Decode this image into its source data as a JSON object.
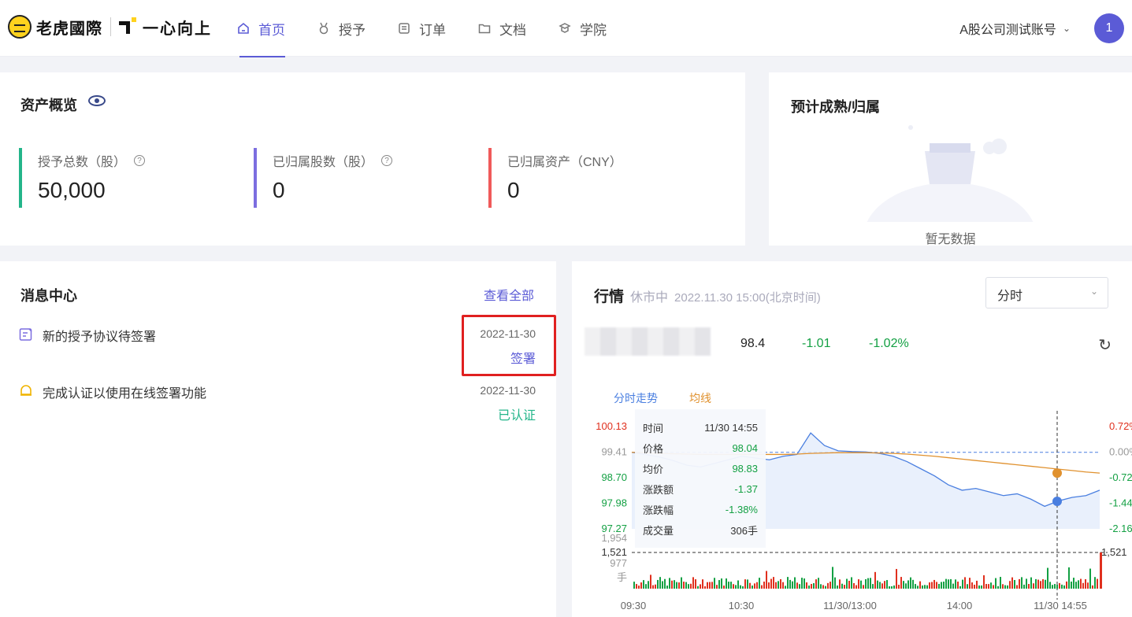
{
  "header": {
    "logo_text": "老虎國際",
    "logo2_text": "一心向上",
    "nav": [
      {
        "label": "首页",
        "icon": "home-icon",
        "active": true
      },
      {
        "label": "授予",
        "icon": "medal-icon",
        "active": false
      },
      {
        "label": "订单",
        "icon": "order-icon",
        "active": false
      },
      {
        "label": "文档",
        "icon": "folder-icon",
        "active": false
      },
      {
        "label": "学院",
        "icon": "academy-icon",
        "active": false
      }
    ],
    "account_label": "A股公司测试账号",
    "avatar_text": "1"
  },
  "assets": {
    "title": "资产概览",
    "stats": [
      {
        "label": "授予总数（股）",
        "value": "50,000",
        "color": "#23b58a",
        "help": true
      },
      {
        "label": "已归属股数（股）",
        "value": "0",
        "color": "#7c6ee0",
        "help": true
      },
      {
        "label": "已归属资产（CNY）",
        "value": "0",
        "color": "#f05a5a",
        "help": false
      }
    ]
  },
  "vesting": {
    "title": "预计成熟/归属",
    "empty_text": "暂无数据"
  },
  "messages": {
    "title": "消息中心",
    "view_all": "查看全部",
    "items": [
      {
        "text": "新的授予协议待签署",
        "date": "2022-11-30",
        "action": "签署",
        "action_color": "#5b5bd6",
        "icon": "sign-document-icon"
      },
      {
        "text": "完成认证以使用在线签署功能",
        "date": "2022-11-30",
        "action": "已认证",
        "action_color": "#23b58a",
        "icon": "bell-icon"
      }
    ]
  },
  "quote": {
    "title": "行情",
    "status": "休市中",
    "time": "2022.11.30 15:00(北京时间)",
    "period": "分时",
    "price": "98.4",
    "change": "-1.01",
    "change_pct": "-1.02%",
    "legend_trend": "分时走势",
    "legend_avg": "均线",
    "colors": {
      "up": "#e0301e",
      "down": "#13a043",
      "trend": "#4a7fe0",
      "avg": "#e0912e"
    },
    "tooltip": {
      "rows": [
        {
          "k": "时间",
          "v": "11/30 14:55",
          "c": "#333"
        },
        {
          "k": "价格",
          "v": "98.04",
          "c": "#13a043"
        },
        {
          "k": "均价",
          "v": "98.83",
          "c": "#13a043"
        },
        {
          "k": "涨跌额",
          "v": "-1.37",
          "c": "#13a043"
        },
        {
          "k": "涨跌幅",
          "v": "-1.38%",
          "c": "#13a043"
        },
        {
          "k": "成交量",
          "v": "306手",
          "c": "#333"
        }
      ]
    }
  },
  "chart_data": {
    "type": "line",
    "x_ticks": [
      "09:30",
      "10:30",
      "11/30/13:00",
      "14:00",
      "11/30 14:55"
    ],
    "y_left_ticks": [
      "100.13",
      "99.41",
      "98.70",
      "97.98",
      "97.27"
    ],
    "y_right_ticks": [
      "0.72%",
      "0.00%",
      "-0.72%",
      "-1.44%",
      "-2.16%"
    ],
    "volume_ticks": [
      "1,954",
      "1,521",
      "977",
      "手"
    ],
    "volume_right_label": "1,521",
    "ylim": [
      97.27,
      100.13
    ],
    "series": [
      {
        "name": "分时走势",
        "values": [
          99.41,
          99.35,
          99.28,
          99.18,
          99.05,
          99.0,
          99.1,
          99.2,
          99.3,
          99.25,
          99.2,
          99.3,
          99.35,
          99.95,
          99.6,
          99.45,
          99.43,
          99.42,
          99.38,
          99.3,
          99.15,
          98.95,
          98.75,
          98.5,
          98.35,
          98.4,
          98.3,
          98.2,
          98.25,
          98.1,
          97.9,
          98.05,
          98.15,
          98.2,
          98.35
        ]
      },
      {
        "name": "均线",
        "values": [
          99.41,
          99.4,
          99.38,
          99.37,
          99.36,
          99.35,
          99.35,
          99.35,
          99.35,
          99.35,
          99.35,
          99.35,
          99.36,
          99.38,
          99.39,
          99.4,
          99.4,
          99.4,
          99.39,
          99.38,
          99.36,
          99.33,
          99.3,
          99.26,
          99.22,
          99.18,
          99.14,
          99.1,
          99.06,
          99.02,
          98.98,
          98.94,
          98.9,
          98.86,
          98.83
        ]
      }
    ]
  }
}
